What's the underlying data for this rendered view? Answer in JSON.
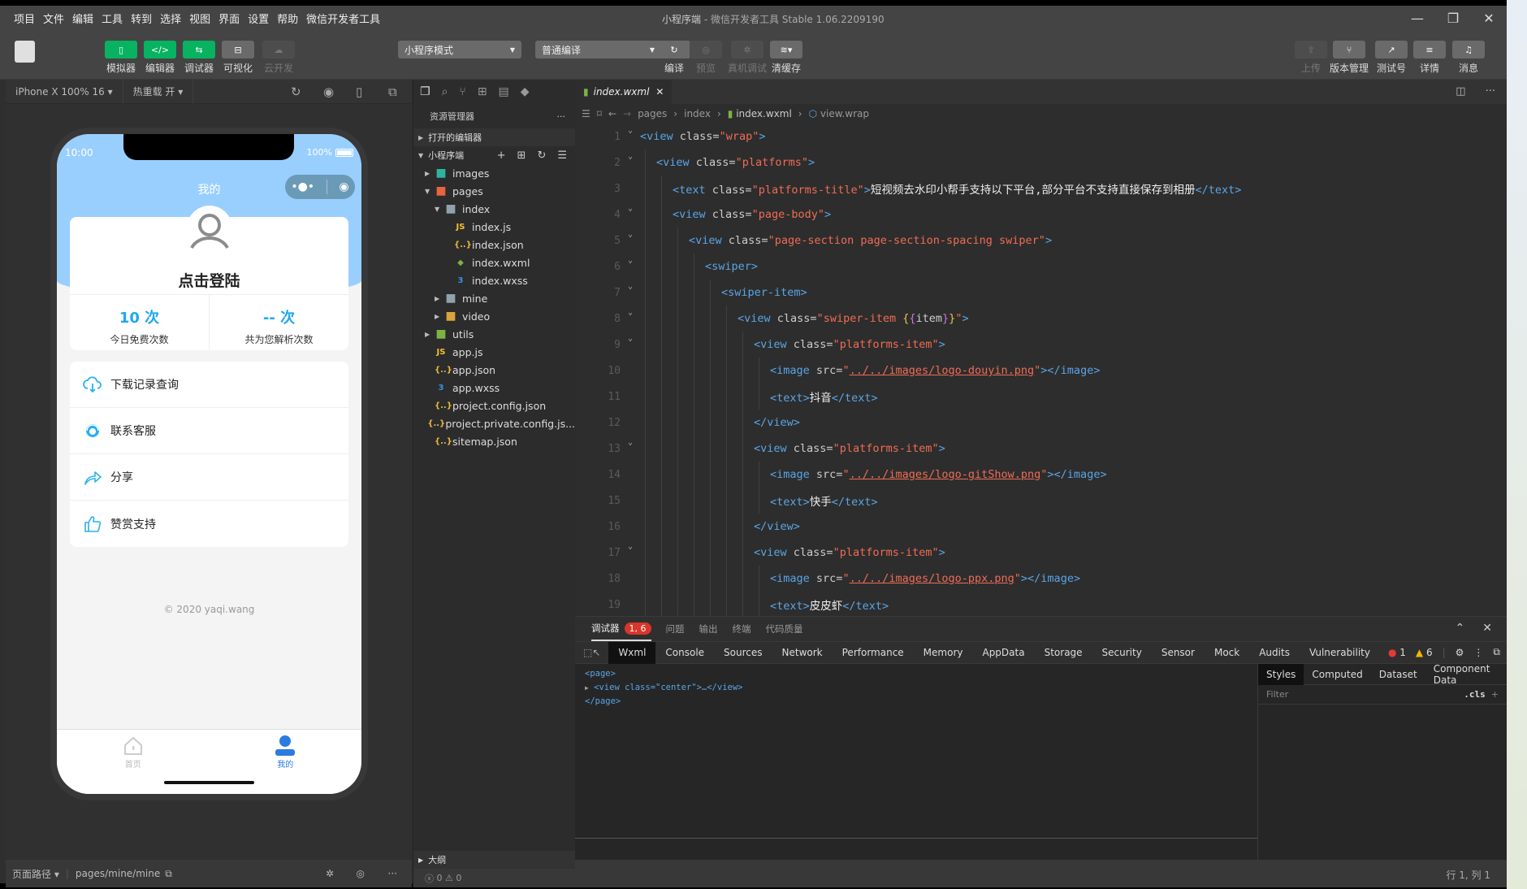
{
  "menubar": {
    "items": [
      "项目",
      "文件",
      "编辑",
      "工具",
      "转到",
      "选择",
      "视图",
      "界面",
      "设置",
      "帮助",
      "微信开发者工具"
    ],
    "title_project": "小程序端",
    "title_app": " - 微信开发者工具 Stable 1.06.2209190",
    "controls": [
      "minimize-icon",
      "restore-icon",
      "close-icon"
    ]
  },
  "toolbar": {
    "left": [
      {
        "label": "模拟器",
        "icon": "phone-icon",
        "glyph": "▯",
        "state": "on"
      },
      {
        "label": "编辑器",
        "icon": "code-icon",
        "glyph": "</>",
        "state": "on"
      },
      {
        "label": "调试器",
        "icon": "sliders-icon",
        "glyph": "⇆",
        "state": "on"
      },
      {
        "label": "可视化",
        "icon": "layout-icon",
        "glyph": "⊟",
        "state": "normal"
      },
      {
        "label": "云开发",
        "icon": "cloud-icon",
        "glyph": "☁",
        "state": "disabled"
      }
    ],
    "mode_select": "小程序模式",
    "compile_select": "普通编译",
    "center": [
      {
        "label": "编译",
        "icon": "refresh-icon",
        "glyph": "↻",
        "state": "normal"
      },
      {
        "label": "预览",
        "icon": "eye-icon",
        "glyph": "◎",
        "state": "disabled"
      },
      {
        "label": "真机调试",
        "icon": "bug-icon",
        "glyph": "✲",
        "state": "disabled"
      },
      {
        "label": "清缓存",
        "icon": "layers-icon",
        "glyph": "≋▾",
        "state": "normal"
      }
    ],
    "right": [
      {
        "label": "上传",
        "icon": "upload-icon",
        "glyph": "⇪",
        "state": "disabled"
      },
      {
        "label": "版本管理",
        "icon": "branch-icon",
        "glyph": "⑂",
        "state": "normal"
      },
      {
        "label": "测试号",
        "icon": "external-icon",
        "glyph": "↗",
        "state": "normal"
      },
      {
        "label": "详情",
        "icon": "menu-icon",
        "glyph": "≡",
        "state": "normal"
      },
      {
        "label": "消息",
        "icon": "bell-icon",
        "glyph": "♫",
        "state": "normal"
      }
    ]
  },
  "simulator": {
    "device": "iPhone X 100% 16",
    "hot_reload": "热重载 开",
    "status_time": "10:00",
    "battery": "100%",
    "nav_title": "我的",
    "login_text": "点击登陆",
    "stats": [
      {
        "value": "10 次",
        "label": "今日免费次数"
      },
      {
        "value": "-- 次",
        "label": "共为您解析次数"
      }
    ],
    "menu": [
      {
        "label": "下载记录查询",
        "icon": "cloud-download-icon"
      },
      {
        "label": "联系客服",
        "icon": "customer-service-icon"
      },
      {
        "label": "分享",
        "icon": "share-icon"
      },
      {
        "label": "赞赏支持",
        "icon": "thumbs-up-icon"
      }
    ],
    "copyright": "© 2020 yaqi.wang",
    "tabbar": [
      {
        "label": "首页",
        "active": false
      },
      {
        "label": "我的",
        "active": true
      }
    ],
    "accent_color": "#1fa8f0",
    "header_color": "#99cfff",
    "footer_path_label": "页面路径",
    "footer_path": "pages/mine/mine"
  },
  "explorer": {
    "title": "资源管理器",
    "open_editors": "打开的编辑器",
    "project": "小程序端",
    "tree": [
      {
        "name": "images",
        "type": "folder",
        "depth": 0,
        "expanded": false,
        "color": "#2bb5a0"
      },
      {
        "name": "pages",
        "type": "folder",
        "depth": 0,
        "expanded": true,
        "color": "#e7643f"
      },
      {
        "name": "index",
        "type": "folder",
        "depth": 1,
        "expanded": true,
        "color": "#8fa2ad"
      },
      {
        "name": "index.js",
        "type": "js",
        "depth": 2
      },
      {
        "name": "index.json",
        "type": "json",
        "depth": 2
      },
      {
        "name": "index.wxml",
        "type": "wxml",
        "depth": 2
      },
      {
        "name": "index.wxss",
        "type": "wxss",
        "depth": 2
      },
      {
        "name": "mine",
        "type": "folder",
        "depth": 1,
        "expanded": false,
        "color": "#8fa2ad"
      },
      {
        "name": "video",
        "type": "folder",
        "depth": 1,
        "expanded": false,
        "color": "#d9a53b"
      },
      {
        "name": "utils",
        "type": "folder",
        "depth": 0,
        "expanded": false,
        "color": "#7cb342"
      },
      {
        "name": "app.js",
        "type": "js",
        "depth": 0
      },
      {
        "name": "app.json",
        "type": "json",
        "depth": 0
      },
      {
        "name": "app.wxss",
        "type": "wxss",
        "depth": 0
      },
      {
        "name": "project.config.json",
        "type": "json",
        "depth": 0
      },
      {
        "name": "project.private.config.js...",
        "type": "json",
        "depth": 0
      },
      {
        "name": "sitemap.json",
        "type": "json",
        "depth": 0
      }
    ],
    "outline": "大纲",
    "errors": "0",
    "warnings": "0"
  },
  "editor": {
    "tab": "index.wxml",
    "breadcrumb": [
      "pages",
      "index",
      "index.wxml",
      "view.wrap"
    ],
    "lines": [
      {
        "n": 1,
        "fold": true,
        "indent": 0,
        "html": "<span class='tg'>&lt;view</span> <span class='at'>class=</span><span class='st'>\"wrap\"</span><span class='tg'>&gt;</span>"
      },
      {
        "n": 2,
        "fold": true,
        "indent": 1,
        "html": "<span class='tg'>&lt;view</span> <span class='at'>class=</span><span class='st'>\"platforms\"</span><span class='tg'>&gt;</span>"
      },
      {
        "n": 3,
        "fold": false,
        "indent": 2,
        "html": "<span class='tg'>&lt;text</span> <span class='at'>class=</span><span class='st'>\"platforms-title\"</span><span class='tg'>&gt;</span><span class='tx'>短视频去水印小帮手支持以下平台,部分平台不支持直接保存到相册</span><span class='tg'>&lt;/text&gt;</span>"
      },
      {
        "n": 4,
        "fold": true,
        "indent": 2,
        "html": "<span class='tg'>&lt;view</span> <span class='at'>class=</span><span class='st'>\"page-body\"</span><span class='tg'>&gt;</span>"
      },
      {
        "n": 5,
        "fold": true,
        "indent": 3,
        "html": "<span class='tg'>&lt;view</span> <span class='at'>class=</span><span class='st'>\"page-section page-section-spacing swiper\"</span><span class='tg'>&gt;</span>"
      },
      {
        "n": 6,
        "fold": true,
        "indent": 4,
        "html": "<span class='tg'>&lt;swiper&gt;</span>"
      },
      {
        "n": 7,
        "fold": true,
        "indent": 5,
        "html": "<span class='tg'>&lt;swiper-item&gt;</span>"
      },
      {
        "n": 8,
        "fold": true,
        "indent": 6,
        "html": "<span class='tg'>&lt;view</span> <span class='at'>class=</span><span class='st'>\"swiper-item </span><span class='br'>{</span><span class='br2'>{</span><span class='at'>item</span><span class='br2'>}</span><span class='br'>}</span><span class='st'>\"</span><span class='tg'>&gt;</span>"
      },
      {
        "n": 9,
        "fold": true,
        "indent": 7,
        "html": "<span class='tg'>&lt;view</span> <span class='at'>class=</span><span class='st'>\"platforms-item\"</span><span class='tg'>&gt;</span>"
      },
      {
        "n": 10,
        "fold": false,
        "indent": 8,
        "html": "<span class='tg'>&lt;image</span> <span class='at'>src=</span><span class='st'>\"</span><span class='lk'>../../images/logo-douyin.png</span><span class='st'>\"</span><span class='tg'>&gt;&lt;/image&gt;</span>"
      },
      {
        "n": 11,
        "fold": false,
        "indent": 8,
        "html": "<span class='tg'>&lt;text&gt;</span><span class='tx'>抖音</span><span class='tg'>&lt;/text&gt;</span>"
      },
      {
        "n": 12,
        "fold": false,
        "indent": 7,
        "html": "<span class='tg'>&lt;/view&gt;</span>"
      },
      {
        "n": 13,
        "fold": true,
        "indent": 7,
        "html": "<span class='tg'>&lt;view</span> <span class='at'>class=</span><span class='st'>\"platforms-item\"</span><span class='tg'>&gt;</span>"
      },
      {
        "n": 14,
        "fold": false,
        "indent": 8,
        "html": "<span class='tg'>&lt;image</span> <span class='at'>src=</span><span class='st'>\"</span><span class='lk'>../../images/logo-gitShow.png</span><span class='st'>\"</span><span class='tg'>&gt;&lt;/image&gt;</span>"
      },
      {
        "n": 15,
        "fold": false,
        "indent": 8,
        "html": "<span class='tg'>&lt;text&gt;</span><span class='tx'>快手</span><span class='tg'>&lt;/text&gt;</span>"
      },
      {
        "n": 16,
        "fold": false,
        "indent": 7,
        "html": "<span class='tg'>&lt;/view&gt;</span>"
      },
      {
        "n": 17,
        "fold": true,
        "indent": 7,
        "html": "<span class='tg'>&lt;view</span> <span class='at'>class=</span><span class='st'>\"platforms-item\"</span><span class='tg'>&gt;</span>"
      },
      {
        "n": 18,
        "fold": false,
        "indent": 8,
        "html": "<span class='tg'>&lt;image</span> <span class='at'>src=</span><span class='st'>\"</span><span class='lk'>../../images/logo-ppx.png</span><span class='st'>\"</span><span class='tg'>&gt;&lt;/image&gt;</span>"
      },
      {
        "n": 19,
        "fold": false,
        "indent": 8,
        "html": "<span class='tg'>&lt;text&gt;</span><span class='tx'>皮皮虾</span><span class='tg'>&lt;/text&gt;</span>"
      }
    ]
  },
  "debugger": {
    "tabs": [
      "调试器",
      "问题",
      "输出",
      "终端",
      "代码质量"
    ],
    "badge": "1, 6",
    "panels": [
      "Wxml",
      "Console",
      "Sources",
      "Network",
      "Performance",
      "Memory",
      "AppData",
      "Storage",
      "Security",
      "Sensor",
      "Mock",
      "Audits",
      "Vulnerability"
    ],
    "active_panel": "Wxml",
    "errors": "1",
    "warnings": "6",
    "dom": [
      "<page>",
      "<view class=\"center\">…</view>",
      "</page>"
    ],
    "style_tabs": [
      "Styles",
      "Computed",
      "Dataset",
      "Component Data"
    ],
    "filter_placeholder": "Filter",
    "cls": ".cls"
  },
  "statusbar": {
    "position": "行 1, 列 1"
  }
}
